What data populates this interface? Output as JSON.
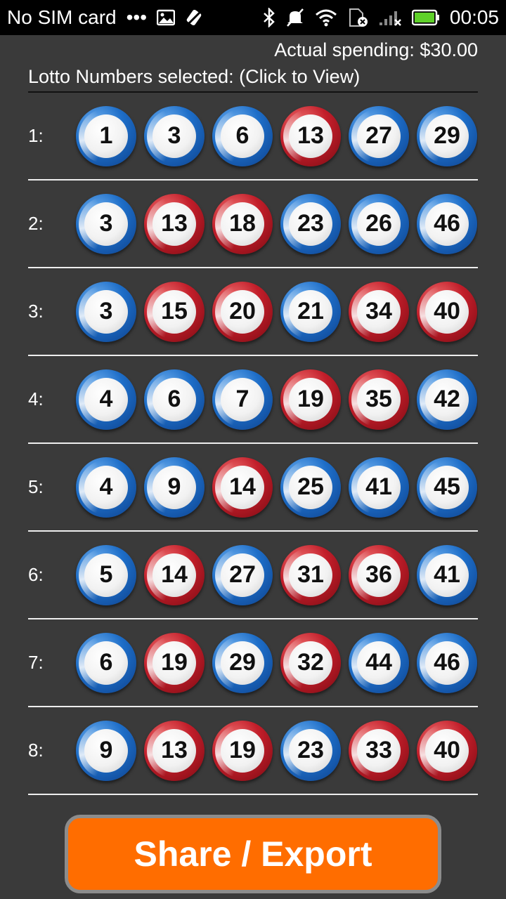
{
  "status_bar": {
    "carrier": "No SIM card",
    "dots": "•••",
    "time": "00:05",
    "icons": [
      "image-icon",
      "signal-off-icon",
      "bluetooth-icon",
      "mute-icon",
      "wifi-icon",
      "sim-error-icon",
      "cell-signal-icon",
      "battery-icon"
    ]
  },
  "header": {
    "spending": "Actual spending: $30.00",
    "selected_label": "Lotto Numbers selected: (Click to View)"
  },
  "rows": [
    {
      "label": "1:",
      "balls": [
        {
          "n": "1",
          "c": "blue"
        },
        {
          "n": "3",
          "c": "blue"
        },
        {
          "n": "6",
          "c": "blue"
        },
        {
          "n": "13",
          "c": "red"
        },
        {
          "n": "27",
          "c": "blue"
        },
        {
          "n": "29",
          "c": "blue"
        }
      ]
    },
    {
      "label": "2:",
      "balls": [
        {
          "n": "3",
          "c": "blue"
        },
        {
          "n": "13",
          "c": "red"
        },
        {
          "n": "18",
          "c": "red"
        },
        {
          "n": "23",
          "c": "blue"
        },
        {
          "n": "26",
          "c": "blue"
        },
        {
          "n": "46",
          "c": "blue"
        }
      ]
    },
    {
      "label": "3:",
      "balls": [
        {
          "n": "3",
          "c": "blue"
        },
        {
          "n": "15",
          "c": "red"
        },
        {
          "n": "20",
          "c": "red"
        },
        {
          "n": "21",
          "c": "blue"
        },
        {
          "n": "34",
          "c": "red"
        },
        {
          "n": "40",
          "c": "red"
        }
      ]
    },
    {
      "label": "4:",
      "balls": [
        {
          "n": "4",
          "c": "blue"
        },
        {
          "n": "6",
          "c": "blue"
        },
        {
          "n": "7",
          "c": "blue"
        },
        {
          "n": "19",
          "c": "red"
        },
        {
          "n": "35",
          "c": "red"
        },
        {
          "n": "42",
          "c": "blue"
        }
      ]
    },
    {
      "label": "5:",
      "balls": [
        {
          "n": "4",
          "c": "blue"
        },
        {
          "n": "9",
          "c": "blue"
        },
        {
          "n": "14",
          "c": "red"
        },
        {
          "n": "25",
          "c": "blue"
        },
        {
          "n": "41",
          "c": "blue"
        },
        {
          "n": "45",
          "c": "blue"
        }
      ]
    },
    {
      "label": "6:",
      "balls": [
        {
          "n": "5",
          "c": "blue"
        },
        {
          "n": "14",
          "c": "red"
        },
        {
          "n": "27",
          "c": "blue"
        },
        {
          "n": "31",
          "c": "red"
        },
        {
          "n": "36",
          "c": "red"
        },
        {
          "n": "41",
          "c": "blue"
        }
      ]
    },
    {
      "label": "7:",
      "balls": [
        {
          "n": "6",
          "c": "blue"
        },
        {
          "n": "19",
          "c": "red"
        },
        {
          "n": "29",
          "c": "blue"
        },
        {
          "n": "32",
          "c": "red"
        },
        {
          "n": "44",
          "c": "blue"
        },
        {
          "n": "46",
          "c": "blue"
        }
      ]
    },
    {
      "label": "8:",
      "balls": [
        {
          "n": "9",
          "c": "blue"
        },
        {
          "n": "13",
          "c": "red"
        },
        {
          "n": "19",
          "c": "red"
        },
        {
          "n": "23",
          "c": "blue"
        },
        {
          "n": "33",
          "c": "red"
        },
        {
          "n": "40",
          "c": "red"
        }
      ]
    }
  ],
  "share_button": "Share / Export",
  "colors": {
    "background": "#3a3a3a",
    "button": "#ff6d00",
    "ball_blue": "#1e6ec8",
    "ball_red": "#c21e2a"
  }
}
